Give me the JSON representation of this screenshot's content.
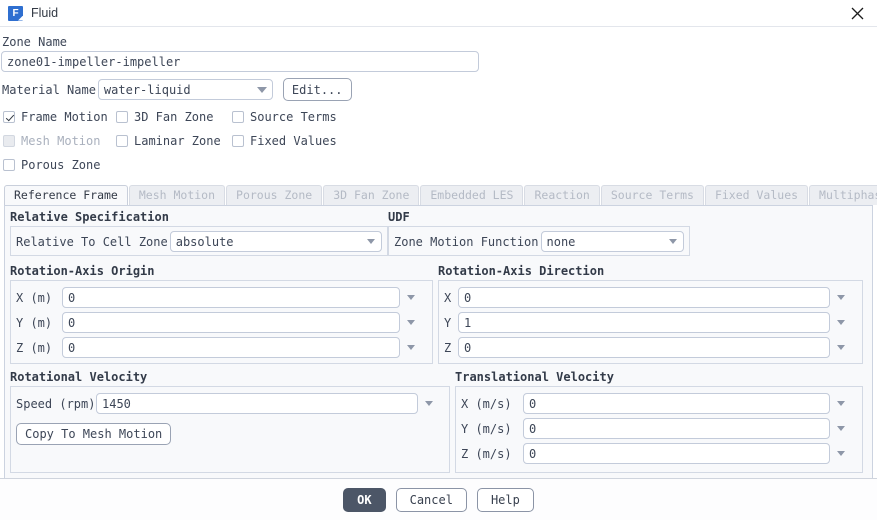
{
  "window": {
    "title": "Fluid",
    "icon": "fluent-app-icon",
    "close_icon": "close-icon"
  },
  "zone": {
    "name_label": "Zone Name",
    "name_value": "zone01-impeller-impeller"
  },
  "material": {
    "label": "Material Name",
    "value": "water-liquid",
    "edit_label": "Edit..."
  },
  "checkboxes": [
    {
      "label": "Frame Motion",
      "checked": true,
      "disabled": false
    },
    {
      "label": "3D Fan Zone",
      "checked": false,
      "disabled": false
    },
    {
      "label": "Source Terms",
      "checked": false,
      "disabled": false
    },
    {
      "label": "Mesh Motion",
      "checked": false,
      "disabled": true
    },
    {
      "label": "Laminar Zone",
      "checked": false,
      "disabled": false
    },
    {
      "label": "Fixed Values",
      "checked": false,
      "disabled": false
    },
    {
      "label": "Porous Zone",
      "checked": false,
      "disabled": false
    }
  ],
  "tabs": [
    {
      "label": "Reference Frame",
      "active": true
    },
    {
      "label": "Mesh Motion",
      "active": false
    },
    {
      "label": "Porous Zone",
      "active": false
    },
    {
      "label": "3D Fan Zone",
      "active": false
    },
    {
      "label": "Embedded LES",
      "active": false
    },
    {
      "label": "Reaction",
      "active": false
    },
    {
      "label": "Source Terms",
      "active": false
    },
    {
      "label": "Fixed Values",
      "active": false
    },
    {
      "label": "Multiphase",
      "active": false
    }
  ],
  "relative_specification": {
    "title": "Relative Specification",
    "field_label": "Relative To Cell Zone",
    "value": "absolute"
  },
  "udf": {
    "title": "UDF",
    "field_label": "Zone Motion Function",
    "value": "none"
  },
  "rotation_axis_origin": {
    "title": "Rotation-Axis Origin",
    "fields": [
      {
        "label": "X (m)",
        "value": "0"
      },
      {
        "label": "Y (m)",
        "value": "0"
      },
      {
        "label": "Z (m)",
        "value": "0"
      }
    ]
  },
  "rotation_axis_direction": {
    "title": "Rotation-Axis Direction",
    "fields": [
      {
        "label": "X",
        "value": "0"
      },
      {
        "label": "Y",
        "value": "1"
      },
      {
        "label": "Z",
        "value": "0"
      }
    ]
  },
  "rotational_velocity": {
    "title": "Rotational Velocity",
    "speed_label": "Speed (rpm)",
    "speed_value": "1450",
    "copy_button": "Copy To Mesh Motion"
  },
  "translational_velocity": {
    "title": "Translational Velocity",
    "fields": [
      {
        "label": "X (m/s)",
        "value": "0"
      },
      {
        "label": "Y (m/s)",
        "value": "0"
      },
      {
        "label": "Z (m/s)",
        "value": "0"
      }
    ]
  },
  "footer": {
    "ok": "OK",
    "cancel": "Cancel",
    "help": "Help"
  },
  "colors": {
    "accent": "#4c5667",
    "icon_blue": "#2f6fd0",
    "panel_bg": "#f8f9fb",
    "border": "#ccd3e0"
  }
}
